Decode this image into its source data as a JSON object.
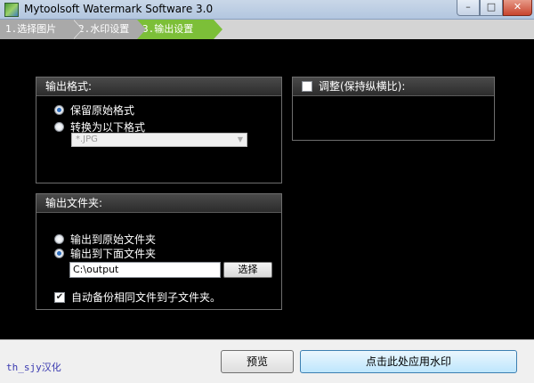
{
  "window": {
    "title": "Mytoolsoft Watermark Software 3.0",
    "min_glyph": "–",
    "max_glyph": "□",
    "close_glyph": "✕"
  },
  "steps": [
    {
      "label": "1.选择图片",
      "active": false
    },
    {
      "label": "2.水印设置",
      "active": false
    },
    {
      "label": "3.输出设置",
      "active": true
    }
  ],
  "output_format": {
    "title": "输出格式:",
    "options": [
      {
        "label": "保留原始格式",
        "selected": true
      },
      {
        "label": "转换为以下格式",
        "selected": false
      }
    ],
    "format_value": "*.JPG"
  },
  "output_folder": {
    "title": "输出文件夹:",
    "options": [
      {
        "label": "输出到原始文件夹",
        "selected": false
      },
      {
        "label": "输出到下面文件夹",
        "selected": true
      }
    ],
    "path_value": "C:\\output",
    "choose_label": "选择",
    "backup_label": "自动备份相同文件到子文件夹。",
    "backup_checked": true
  },
  "adjust": {
    "label": "调整(保持纵横比):",
    "checked": false
  },
  "footer": {
    "credit": "th_sjy汉化",
    "preview_label": "预览",
    "apply_label": "点击此处应用水印"
  }
}
